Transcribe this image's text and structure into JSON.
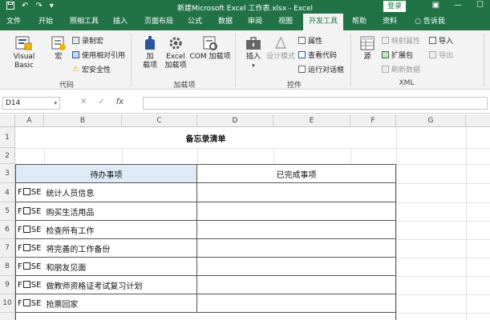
{
  "titlebar": {
    "title": "新建Microsoft Excel 工作表.xlsx  -  Excel",
    "login": "登录"
  },
  "tabs": [
    {
      "label": "文件"
    },
    {
      "label": "开始"
    },
    {
      "label": "照相工具"
    },
    {
      "label": "插入"
    },
    {
      "label": "页面布局"
    },
    {
      "label": "公式"
    },
    {
      "label": "数据"
    },
    {
      "label": "审阅"
    },
    {
      "label": "视图"
    },
    {
      "label": "开发工具"
    },
    {
      "label": "帮助"
    },
    {
      "label": "资料"
    },
    {
      "label": "告诉我"
    }
  ],
  "ribbon": {
    "code": {
      "visual_basic": "Visual Basic",
      "macro": "宏",
      "record_macro": "录制宏",
      "relative_ref": "使用相对引用",
      "macro_security": "宏安全性",
      "label": "代码"
    },
    "addins": {
      "addin": "加\n载项",
      "excel_addin": "Excel\n加载项",
      "com_addin": "COM 加载项",
      "label": "加载项"
    },
    "controls": {
      "insert": "插入",
      "design_mode": "设计模式",
      "properties": "属性",
      "view_code": "查看代码",
      "run_dialog": "运行对话框",
      "label": "控件"
    },
    "xml": {
      "source": "源",
      "map_properties": "映射属性",
      "expansion_pack": "扩展包",
      "refresh_data": "刷新数据",
      "import": "导入",
      "export": "导出",
      "label": "XML"
    }
  },
  "formula_bar": {
    "name_box": "D14",
    "fx": "fx",
    "value": ""
  },
  "columns": [
    "A",
    "B",
    "C",
    "D",
    "E",
    "F",
    "G"
  ],
  "rows": [
    "1",
    "2",
    "3",
    "4",
    "5",
    "6",
    "7",
    "8",
    "9",
    "10"
  ],
  "sheet": {
    "title": "备忘录清单",
    "pending_header": "待办事项",
    "done_header": "已完成事项",
    "checkbox_label_pre": "F",
    "checkbox_label_post": "SE",
    "tasks": [
      {
        "text": "统计人员信息"
      },
      {
        "text": "购买生活用品"
      },
      {
        "text": "检查所有工作"
      },
      {
        "text": "将完善的工作备份"
      },
      {
        "text": "和朋友见面"
      },
      {
        "text": "做教师资格证考试复习计划"
      },
      {
        "text": "抢票回家"
      }
    ]
  },
  "colors": {
    "excel_green": "#217346",
    "header_fill": "#dcebf7"
  }
}
